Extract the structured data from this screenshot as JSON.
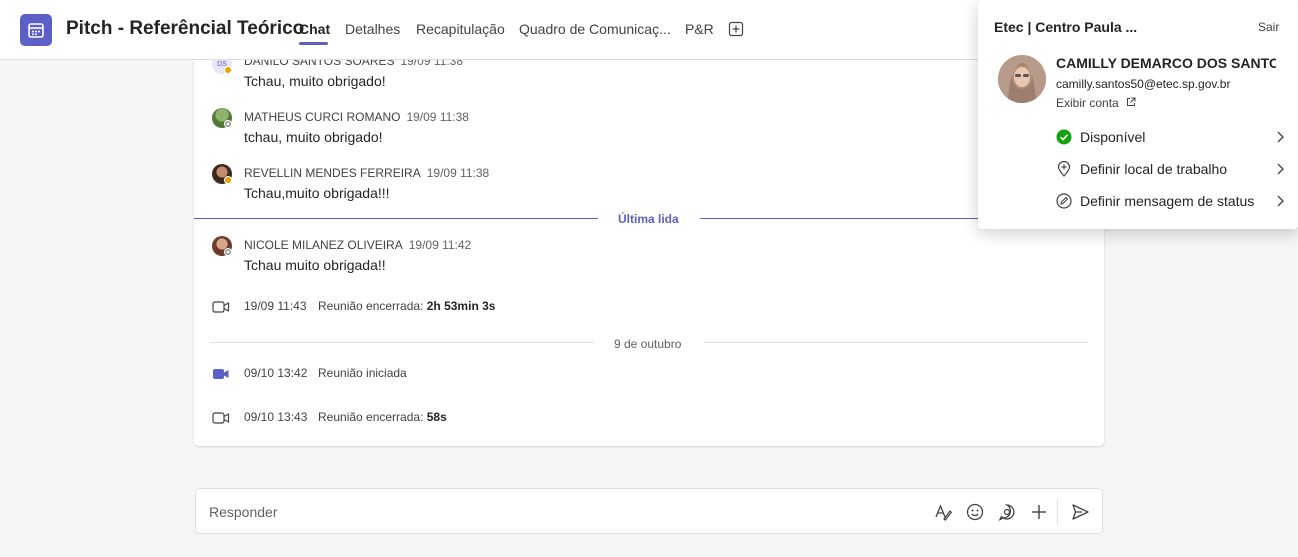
{
  "header": {
    "title": "Pitch - Referêncial Teórico",
    "tabs": [
      {
        "label": "Chat",
        "active": true
      },
      {
        "label": "Detalhes",
        "active": false
      },
      {
        "label": "Recapitulação",
        "active": false
      },
      {
        "label": "Quadro de Comunicaç...",
        "active": false
      },
      {
        "label": "P&R",
        "active": false
      }
    ],
    "add_tab_icon": "plus-square-icon"
  },
  "messages": [
    {
      "author": "DANILO SANTOS SOARES",
      "time": "19/09 11:38",
      "text": "Tchau, muito obrigado!",
      "avatar_initials": "DS",
      "presence": "away"
    },
    {
      "author": "MATHEUS CURCI ROMANO",
      "time": "19/09 11:38",
      "text": "tchau, muito obrigado!",
      "avatar_initials": "",
      "presence": "offline"
    },
    {
      "author": "REVELLIN MENDES FERREIRA",
      "time": "19/09 11:38",
      "text": "Tchau,muito obrigada!!!",
      "avatar_initials": "",
      "presence": "away"
    },
    {
      "author": "NICOLE MILANEZ OLIVEIRA",
      "time": "19/09 11:42",
      "text": "Tchau muito obrigada!!",
      "avatar_initials": "",
      "presence": "offline"
    }
  ],
  "last_read_label": "Última lida",
  "date_divider": "9 de outubro",
  "events": [
    {
      "time": "19/09 11:43",
      "text": "Reunião encerrada:",
      "duration": "2h 53min 3s",
      "icon": "video-outline-icon"
    },
    {
      "time": "09/10 13:42",
      "text": "Reunião iniciada",
      "duration": "",
      "icon": "video-filled-icon"
    },
    {
      "time": "09/10 13:43",
      "text": "Reunião encerrada:",
      "duration": "58s",
      "icon": "video-outline-icon"
    }
  ],
  "reply": {
    "placeholder": "Responder",
    "icons": [
      "format-icon",
      "emoji-icon",
      "sticker-icon",
      "plus-icon",
      "send-icon"
    ]
  },
  "profile_popup": {
    "org": "Etec | Centro Paula ...",
    "signout": "Sair",
    "name": "CAMILLY DEMARCO DOS SANTOS",
    "email": "camilly.santos50@etec.sp.gov.br",
    "view_account": "Exibir conta",
    "menu": [
      {
        "label": "Disponível",
        "icon": "available-status-icon"
      },
      {
        "label": "Definir local de trabalho",
        "icon": "location-icon"
      },
      {
        "label": "Definir mensagem de status",
        "icon": "pen-status-icon"
      }
    ]
  },
  "colors": {
    "accent": "#5b5fc7",
    "available": "#13a10e",
    "away": "#eaa300"
  }
}
